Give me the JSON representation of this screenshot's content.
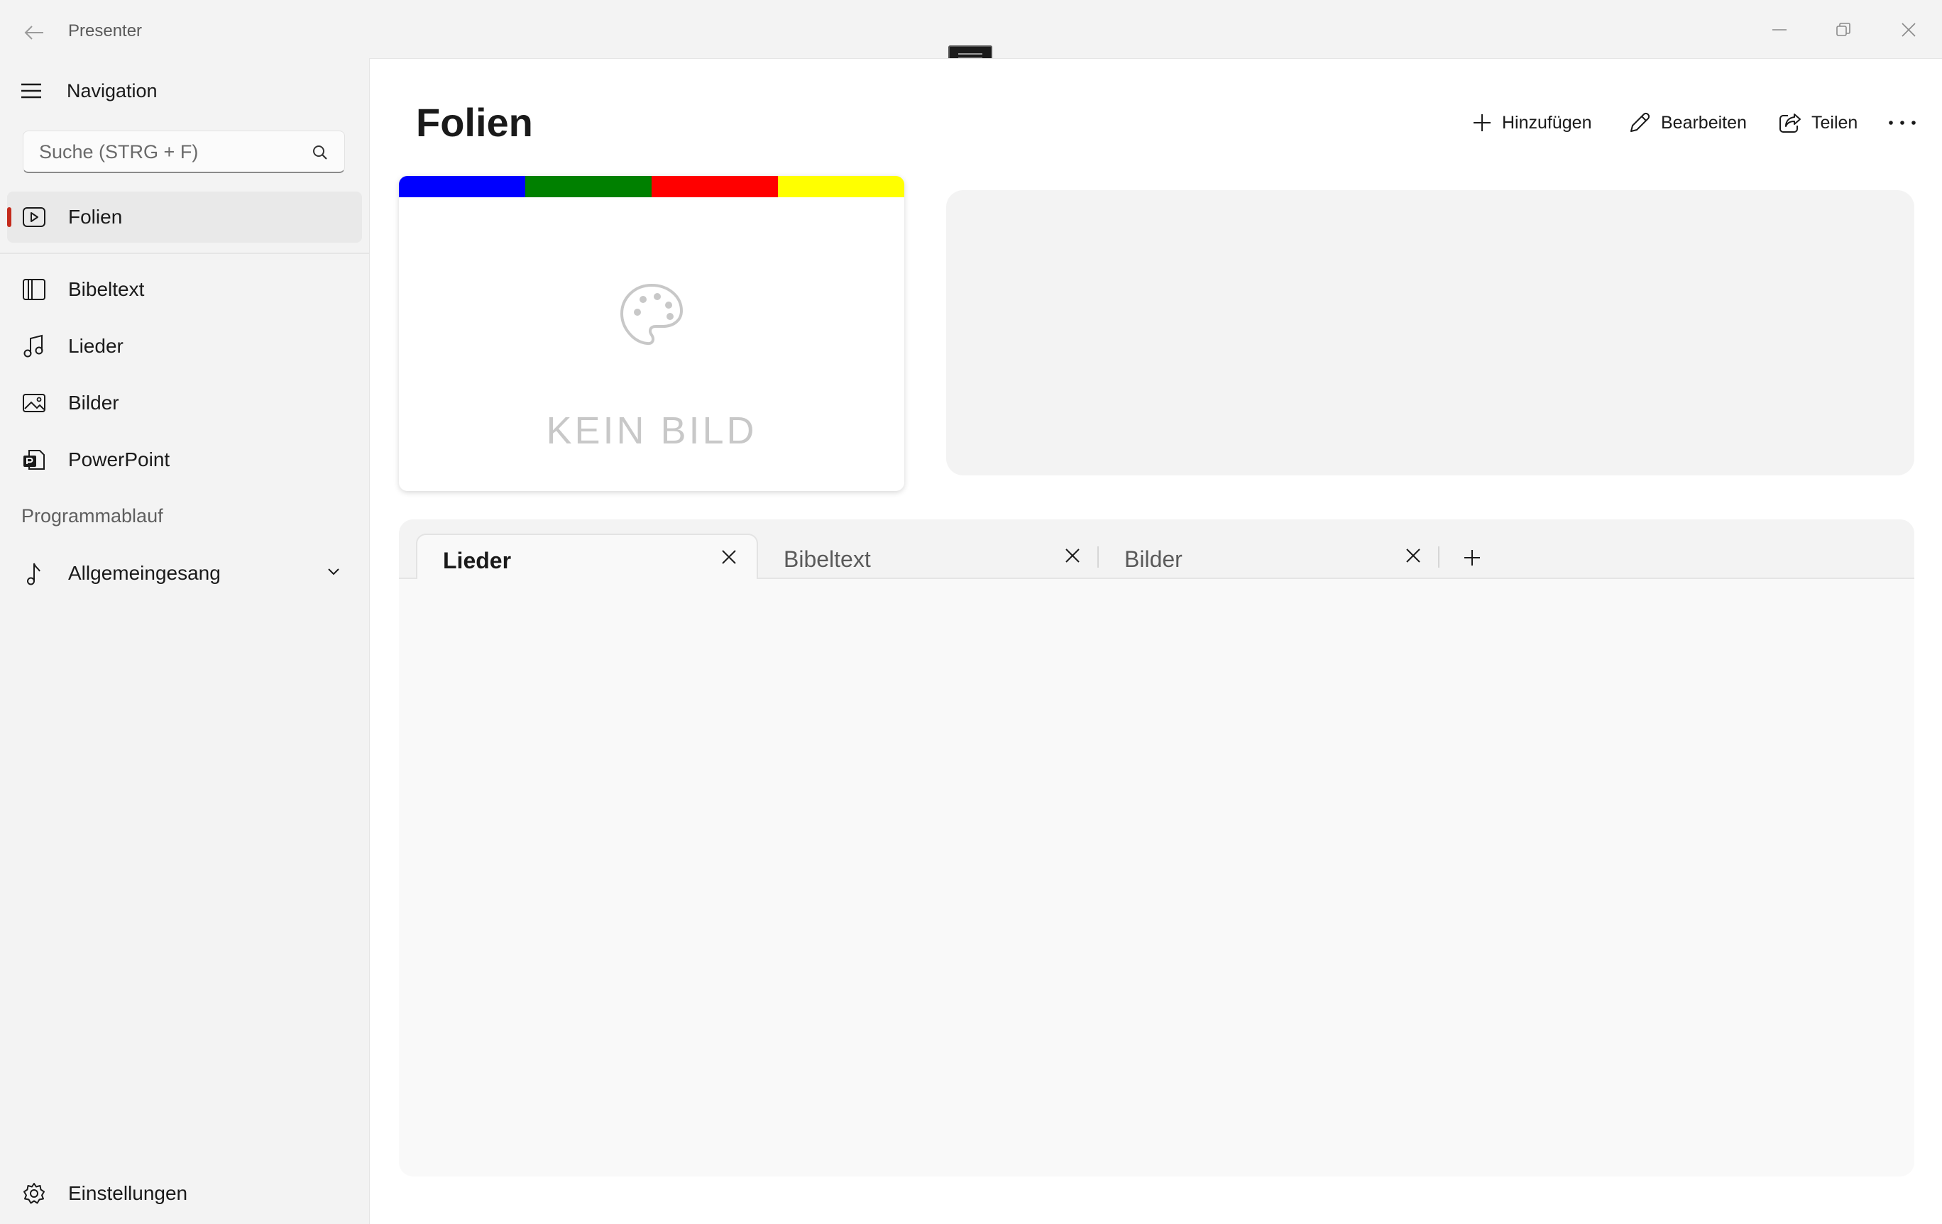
{
  "window": {
    "app_title": "Presenter"
  },
  "navigation": {
    "title": "Navigation",
    "search_placeholder": "Suche (STRG + F)",
    "items": [
      {
        "label": "Folien",
        "icon": "slides-play-icon",
        "selected": true
      },
      {
        "label": "Bibeltext",
        "icon": "book-icon"
      },
      {
        "label": "Lieder",
        "icon": "music-note-icon"
      },
      {
        "label": "Bilder",
        "icon": "image-icon"
      },
      {
        "label": "PowerPoint",
        "icon": "powerpoint-icon"
      }
    ],
    "section_header": "Programmablauf",
    "program_items": [
      {
        "label": "Allgemeingesang",
        "icon": "music-note-single-icon",
        "expandable": true
      }
    ],
    "footer": {
      "label": "Einstellungen",
      "icon": "gear-icon"
    }
  },
  "page": {
    "title": "Folien",
    "commands": [
      {
        "label": "Hinzufügen",
        "icon": "plus-icon"
      },
      {
        "label": "Bearbeiten",
        "icon": "pencil-icon"
      },
      {
        "label": "Teilen",
        "icon": "share-icon"
      }
    ],
    "more_icon": "more-dots-icon"
  },
  "slide_card": {
    "placeholder_text": "KEIN BILD",
    "stripe_colors": [
      "#0000ff",
      "#008000",
      "#ff0000",
      "#ffff00"
    ]
  },
  "tabs": {
    "items": [
      {
        "label": "Lieder",
        "active": true
      },
      {
        "label": "Bibeltext",
        "active": false
      },
      {
        "label": "Bilder",
        "active": false
      }
    ]
  },
  "colors": {
    "accent_indicator": "#c42b1c",
    "content_background": "#ffffff",
    "sidebar_background": "#f3f3f3"
  }
}
